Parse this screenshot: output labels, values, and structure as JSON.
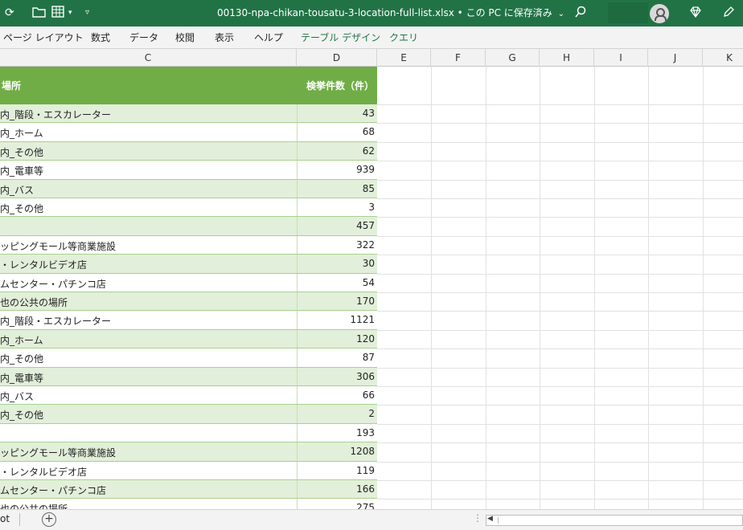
{
  "titlebar": {
    "filename": "00130-npa-chikan-tousatu-3-location-full-list.xlsx",
    "save_status": "• この PC に保存済み",
    "icons": [
      "redo-icon",
      "open-folder-icon",
      "table-icon",
      "customize-icon",
      "search-icon",
      "account-icon",
      "diamond-icon",
      "pen-icon"
    ]
  },
  "ribbon": {
    "tabs": [
      "ページ レイアウト",
      "数式",
      "データ",
      "校閲",
      "表示",
      "ヘルプ",
      "テーブル デザイン",
      "クエリ"
    ]
  },
  "columns": [
    "C",
    "D",
    "E",
    "F",
    "G",
    "H",
    "I",
    "J",
    "K"
  ],
  "table": {
    "header_c": "場所",
    "header_d": "検挙件数（件）",
    "rows": [
      {
        "c": "内_階段・エスカレーター",
        "d": "43"
      },
      {
        "c": "内_ホーム",
        "d": "68"
      },
      {
        "c": "内_その他",
        "d": "62"
      },
      {
        "c": "内_電車等",
        "d": "939"
      },
      {
        "c": "内_バス",
        "d": "85"
      },
      {
        "c": "内_その他",
        "d": "3"
      },
      {
        "c": "",
        "d": "457"
      },
      {
        "c": "ッピングモール等商業施設",
        "d": "322"
      },
      {
        "c": "・レンタルビデオ店",
        "d": "30"
      },
      {
        "c": "ムセンター・パチンコ店",
        "d": "54"
      },
      {
        "c": "也の公共の場所",
        "d": "170"
      },
      {
        "c": "内_階段・エスカレーター",
        "d": "1121"
      },
      {
        "c": "内_ホーム",
        "d": "120"
      },
      {
        "c": "内_その他",
        "d": "87"
      },
      {
        "c": "内_電車等",
        "d": "306"
      },
      {
        "c": "内_バス",
        "d": "66"
      },
      {
        "c": "内_その他",
        "d": "2"
      },
      {
        "c": "",
        "d": "193"
      },
      {
        "c": "ッピングモール等商業施設",
        "d": "1208"
      },
      {
        "c": "・レンタルビデオ店",
        "d": "119"
      },
      {
        "c": "ムセンター・パチンコ店",
        "d": "166"
      },
      {
        "c": "也の公共の場所",
        "d": "275"
      }
    ]
  },
  "bottombar": {
    "sheet_tab": "ot"
  }
}
